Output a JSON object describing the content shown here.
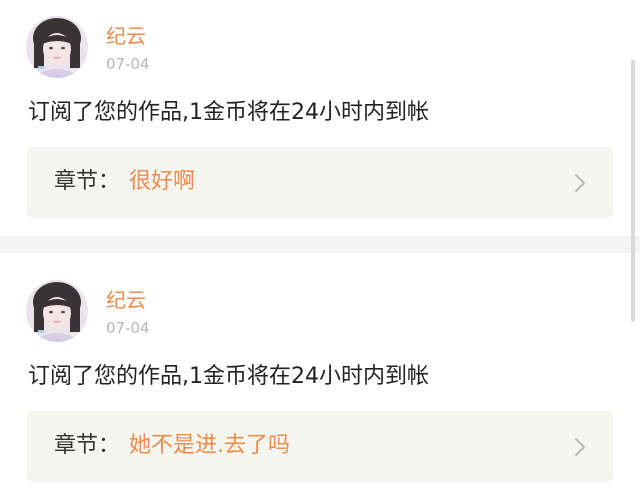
{
  "notifications": [
    {
      "username": "纪云",
      "date": "07-04",
      "message": "订阅了您的作品,1金币将在24小时内到帐",
      "chapter_label": "章节：",
      "chapter_title": "很好啊"
    },
    {
      "username": "纪云",
      "date": "07-04",
      "message": "订阅了您的作品,1金币将在24小时内到帐",
      "chapter_label": "章节：",
      "chapter_title": "她不是进.去了吗"
    }
  ],
  "colors": {
    "accent": "#f08a4b",
    "chapter_box_bg": "#f6f6f1",
    "divider_bg": "#f5f4f4",
    "date_text": "#b5b5b5"
  },
  "icons": {
    "avatar": "user-avatar-photo",
    "chevron": "chevron-right-icon"
  }
}
